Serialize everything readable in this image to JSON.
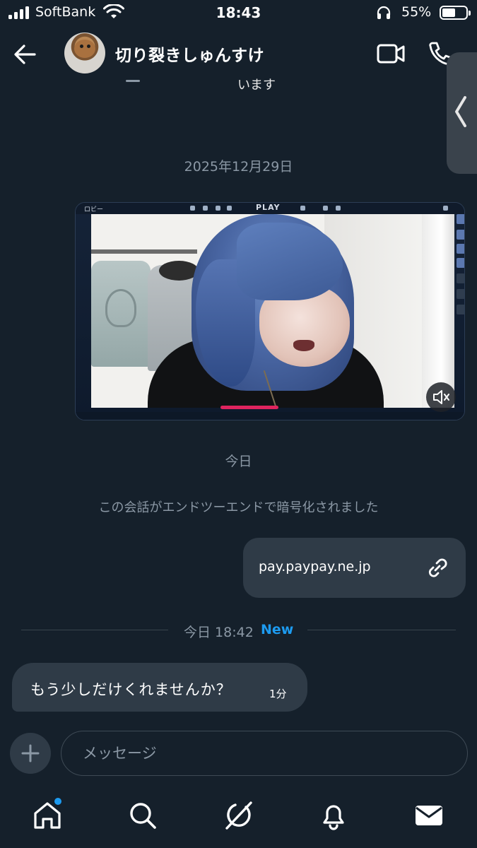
{
  "status_bar": {
    "carrier": "SoftBank",
    "time": "18:43",
    "battery_percent": "55%",
    "battery_level": 0.55
  },
  "header": {
    "contact_name": "切り裂きしゅんすけ"
  },
  "conversation": {
    "cut_off_text": "います",
    "date_old": "2025年12月29日",
    "date_today": "今日",
    "encryption_notice": "この会話がエンドツーエンドで暗号化されました",
    "link_message": "pay.paypay.ne.jp",
    "divider_time": "今日 18:42",
    "divider_new": "New",
    "incoming_message": "もう少しだけくれませんか？",
    "incoming_time": "1分"
  },
  "video_message": {
    "game_title": "PLAY",
    "lobby_label": "ロビー",
    "muted": true
  },
  "composer": {
    "placeholder": "メッセージ"
  },
  "tab_bar": {
    "items": [
      "home",
      "search",
      "grok",
      "notifications",
      "messages"
    ],
    "active": "messages",
    "home_has_badge": true
  },
  "colors": {
    "background": "#15202b",
    "bubble": "#2f3b47",
    "accent": "#1d9bf0",
    "muted_text": "#8b98a5"
  }
}
